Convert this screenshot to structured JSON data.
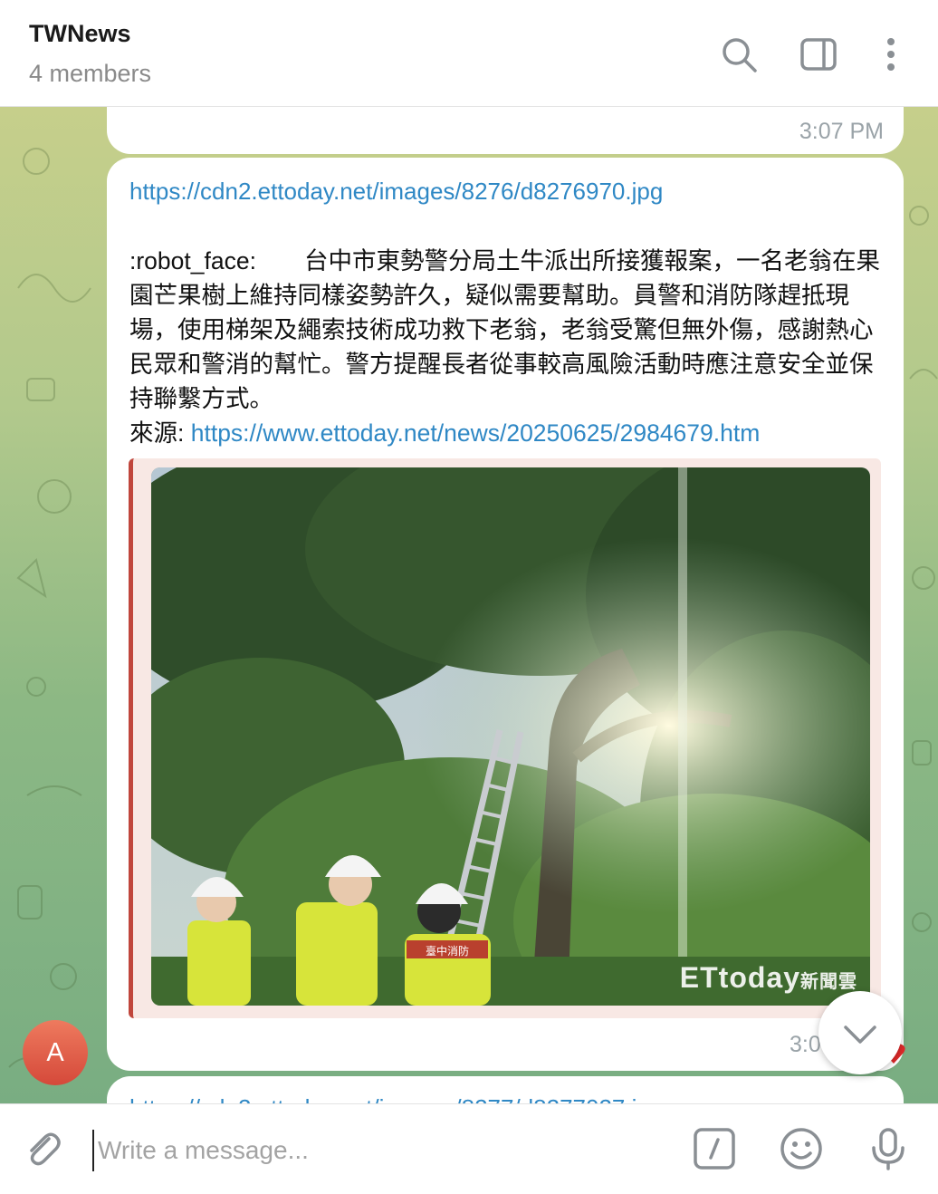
{
  "header": {
    "title": "TWNews",
    "members": "4 members",
    "icons": [
      "search-icon",
      "sidebar-toggle-icon",
      "more-icon"
    ]
  },
  "previous_message": {
    "time": "3:07 PM"
  },
  "message": {
    "image_url": "https://cdn2.ettoday.net/images/8276/d8276970.jpg",
    "body": ":robot_face:  台中市東勢警分局土牛派出所接獲報案，一名老翁在果園芒果樹上維持同樣姿勢許久，疑似需要幫助。員警和消防隊趕抵現場，使用梯架及繩索技術成功救下老翁，老翁受驚但無外傷，感謝熱心民眾和警消的幫忙。警方提醒長者從事較高風險活動時應注意安全並保持聯繫方式。",
    "source_label": "來源: ",
    "source_url": "https://www.ettoday.net/news/20250625/2984679.htm",
    "preview": {
      "watermark": "ETtoday",
      "watermark_cn": "新聞雲",
      "vest_text": "臺中消防",
      "accent_color": "#c0463c"
    },
    "time": "3:0"
  },
  "next_message": {
    "url_partial": "https://cdn2.ettoday.net/images/8277/d8277027.j"
  },
  "avatar": {
    "initial": "A",
    "color": "#e0553f"
  },
  "composer": {
    "placeholder": "Write a message...",
    "icons": [
      "attach-icon",
      "commands-icon",
      "emoji-icon",
      "microphone-icon"
    ]
  }
}
